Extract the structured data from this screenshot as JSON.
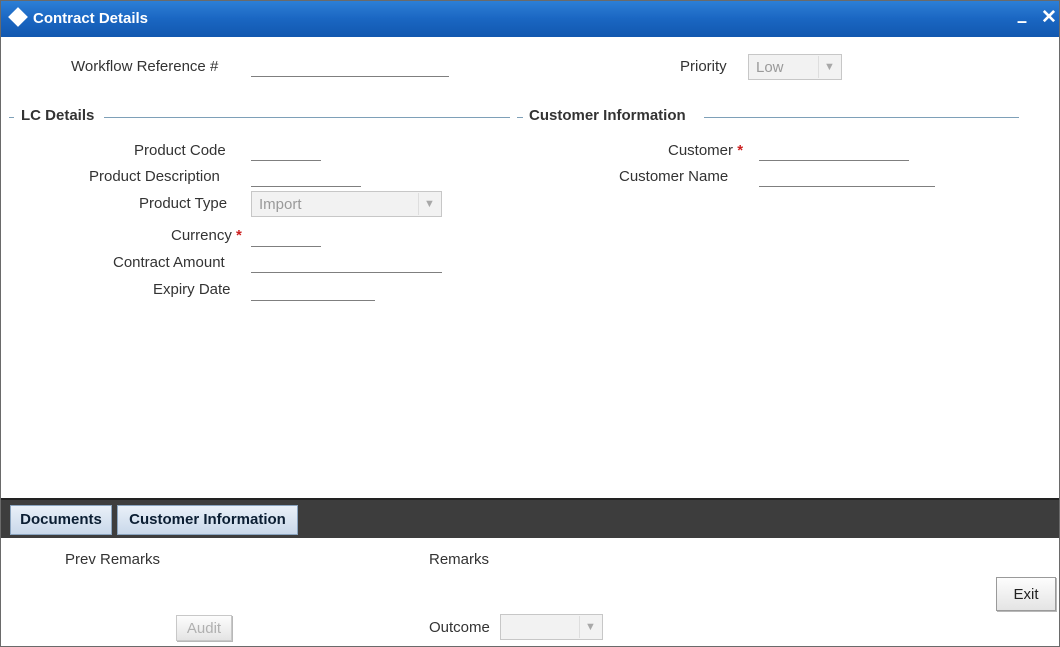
{
  "window": {
    "title": "Contract Details",
    "minimize": "–",
    "close": "✕"
  },
  "header": {
    "workflow_ref_label": "Workflow Reference #",
    "workflow_ref_value": "",
    "priority_label": "Priority",
    "priority_value": "Low"
  },
  "lc_details": {
    "section_title": "LC Details",
    "product_code_label": "Product Code",
    "product_code_value": "",
    "product_description_label": "Product Description",
    "product_description_value": "",
    "product_type_label": "Product Type",
    "product_type_value": "Import",
    "currency_label": "Currency",
    "currency_value": "",
    "contract_amount_label": "Contract Amount",
    "contract_amount_value": "",
    "expiry_date_label": "Expiry Date",
    "expiry_date_value": "",
    "required_marker": "*"
  },
  "customer_info": {
    "section_title": "Customer Information",
    "customer_label": "Customer",
    "customer_value": "",
    "customer_name_label": "Customer Name",
    "customer_name_value": ""
  },
  "tabs": [
    {
      "label": "Documents"
    },
    {
      "label": "Customer Information"
    }
  ],
  "footer": {
    "prev_remarks_label": "Prev Remarks",
    "remarks_label": "Remarks",
    "audit_label": "Audit",
    "outcome_label": "Outcome",
    "outcome_value": "",
    "exit_label": "Exit"
  },
  "icons": {
    "title_icon": "diamond-icon",
    "dropdown_arrow": "chevron-down-icon"
  },
  "colors": {
    "titlebar": "#1a66c2",
    "required": "#cc1f1f",
    "tabbar": "#3d3d3d"
  }
}
